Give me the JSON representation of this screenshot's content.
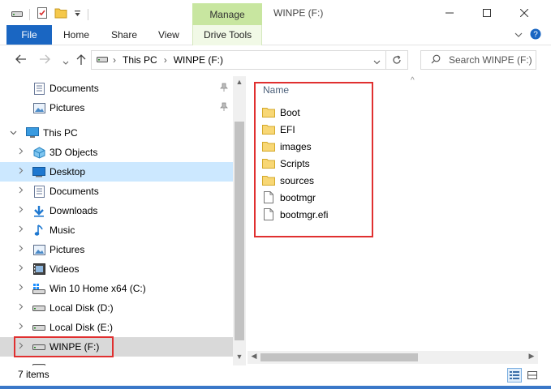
{
  "window": {
    "title": "WINPE (F:)",
    "contextual_tab_group": "Manage"
  },
  "ribbon": {
    "tabs": [
      "File",
      "Home",
      "Share",
      "View",
      "Drive Tools"
    ]
  },
  "address": {
    "path": [
      "This PC",
      "WINPE (F:)"
    ],
    "search_placeholder": "Search WINPE (F:)"
  },
  "nav": {
    "quick_access": [
      {
        "label": "Documents",
        "icon": "documents-icon",
        "pinned": true
      },
      {
        "label": "Pictures",
        "icon": "pictures-icon",
        "pinned": true
      }
    ],
    "this_pc": "This PC",
    "items": [
      {
        "label": "3D Objects",
        "icon": "3d-objects-icon"
      },
      {
        "label": "Desktop",
        "icon": "desktop-icon"
      },
      {
        "label": "Documents",
        "icon": "documents-icon"
      },
      {
        "label": "Downloads",
        "icon": "downloads-icon"
      },
      {
        "label": "Music",
        "icon": "music-icon"
      },
      {
        "label": "Pictures",
        "icon": "pictures-icon"
      },
      {
        "label": "Videos",
        "icon": "videos-icon"
      },
      {
        "label": "Win 10 Home x64 (C:)",
        "icon": "windows-drive-icon"
      },
      {
        "label": "Local Disk (D:)",
        "icon": "drive-icon"
      },
      {
        "label": "Local Disk (E:)",
        "icon": "drive-icon"
      },
      {
        "label": "WINPE (F:)",
        "icon": "drive-icon"
      }
    ]
  },
  "content": {
    "column_header": "Name",
    "files": [
      {
        "name": "Boot",
        "type": "folder"
      },
      {
        "name": "EFI",
        "type": "folder"
      },
      {
        "name": "images",
        "type": "folder"
      },
      {
        "name": "Scripts",
        "type": "folder"
      },
      {
        "name": "sources",
        "type": "folder"
      },
      {
        "name": "bootmgr",
        "type": "file"
      },
      {
        "name": "bootmgr.efi",
        "type": "file"
      }
    ]
  },
  "status": {
    "item_count": "7 items"
  },
  "colors": {
    "accent": "#1a66c2",
    "manage_tab": "#c8e6a0",
    "highlight_box": "#e03030",
    "selection": "#cce8ff"
  }
}
